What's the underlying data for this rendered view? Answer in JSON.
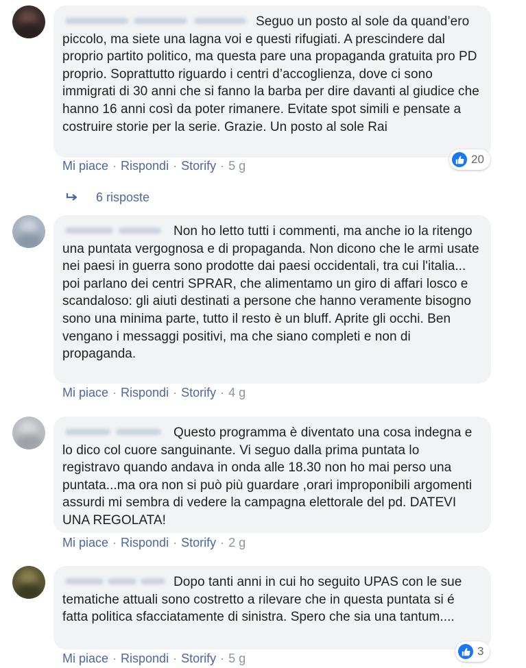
{
  "comments": [
    {
      "text": "Seguo un posto al sole da quand’ero piccolo, ma siete una lagna voi e questi rifugiati. A prescindere dal proprio partito politico, ma questa pare una propaganda gratuita pro PD proprio. Soprattutto riguardo i centri d’accoglienza, dove ci sono immigrati di 30 anni che si fanno la barba per dire davanti al giudice che hanno 16 anni così da poter rimanere. Evitate spot simili e pensate a costruire storie per la serie. Grazie. Un posto al sole Rai",
      "like_label": "Mi piace",
      "reply_label": "Rispondi",
      "storify_label": "Storify",
      "time": "5 g",
      "reaction_count": "20"
    },
    {
      "text": "Non ho letto tutti i commenti, ma anche io la ritengo una puntata vergognosa e di propaganda. Non dicono che le armi usate nei paesi in guerra sono prodotte dai paesi occidentali, tra cui l'italia... poi parlano dei centri SPRAR, che alimentamo un giro di affari losco e scandaloso: gli aiuti destinati a persone che hanno veramente bisogno sono una minima parte, tutto il resto è un bluff. Aprite gli occhi. Ben vengano i messaggi positivi, ma che siano completi e non di propaganda.",
      "like_label": "Mi piace",
      "reply_label": "Rispondi",
      "storify_label": "Storify",
      "time": "4 g"
    },
    {
      "text": "Questo programma è diventato una cosa indegna e lo dico col cuore sanguinante. Vi seguo dalla prima puntata lo registravo quando andava in onda alle 18.30 non ho mai perso una puntata...ma ora non si può più guardare ,orari improponibili argomenti assurdi mi sembra di vedere la campagna elettorale del pd. DATEVI UNA REGOLATA!",
      "like_label": "Mi piace",
      "reply_label": "Rispondi",
      "storify_label": "Storify",
      "time": "2 g"
    },
    {
      "text": "Dopo tanti anni in cui ho seguito UPAS con le sue tematiche attuali sono costretto a rilevare che in questa puntata si é fatta politica sfacciatamente di sinistra. Spero che sia una tantum....",
      "like_label": "Mi piace",
      "reply_label": "Rispondi",
      "storify_label": "Storify",
      "time": "5 g",
      "reaction_count": "3"
    }
  ],
  "replies_link": "6 risposte",
  "colors": {
    "bubble": "#f2f3f5",
    "link": "#4b67a1",
    "meta": "#8d949e",
    "like_badge": "#1877f2"
  }
}
